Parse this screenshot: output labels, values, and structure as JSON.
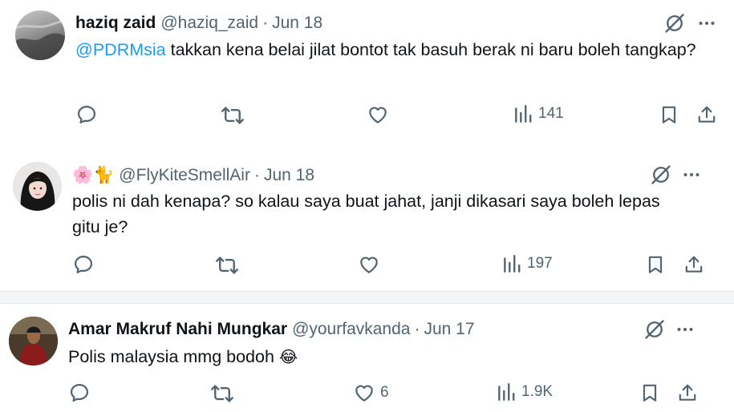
{
  "tweets": [
    {
      "name": "haziq zaid",
      "handle": "@haziq_zaid",
      "date": "Jun 18",
      "mention": "@PDRMsia",
      "text": " takkan kena belai jilat bontot tak basuh berak ni baru boleh tangkap?",
      "views": "141",
      "likes": ""
    },
    {
      "name_emoji": "🌸🐈",
      "handle": "@FlyKiteSmellAir",
      "date": "Jun 18",
      "text": "polis ni dah kenapa? so kalau saya buat jahat, janji dikasari saya boleh lepas gitu je?",
      "views": "197",
      "likes": ""
    },
    {
      "name": "Amar Makruf Nahi Mungkar",
      "handle": "@yourfavkanda",
      "date": "Jun 17",
      "text": "Polis malaysia mmg bodoh ",
      "emoji": "😂",
      "views": "1.9K",
      "likes": "6"
    }
  ],
  "separator": "·",
  "icons": [
    "grok-icon",
    "more-icon",
    "reply-icon",
    "retweet-icon",
    "like-icon",
    "views-icon",
    "bookmark-icon",
    "share-icon"
  ],
  "colors": {
    "text": "#0f1419",
    "muted": "#536471",
    "link": "#1d9bf0"
  }
}
